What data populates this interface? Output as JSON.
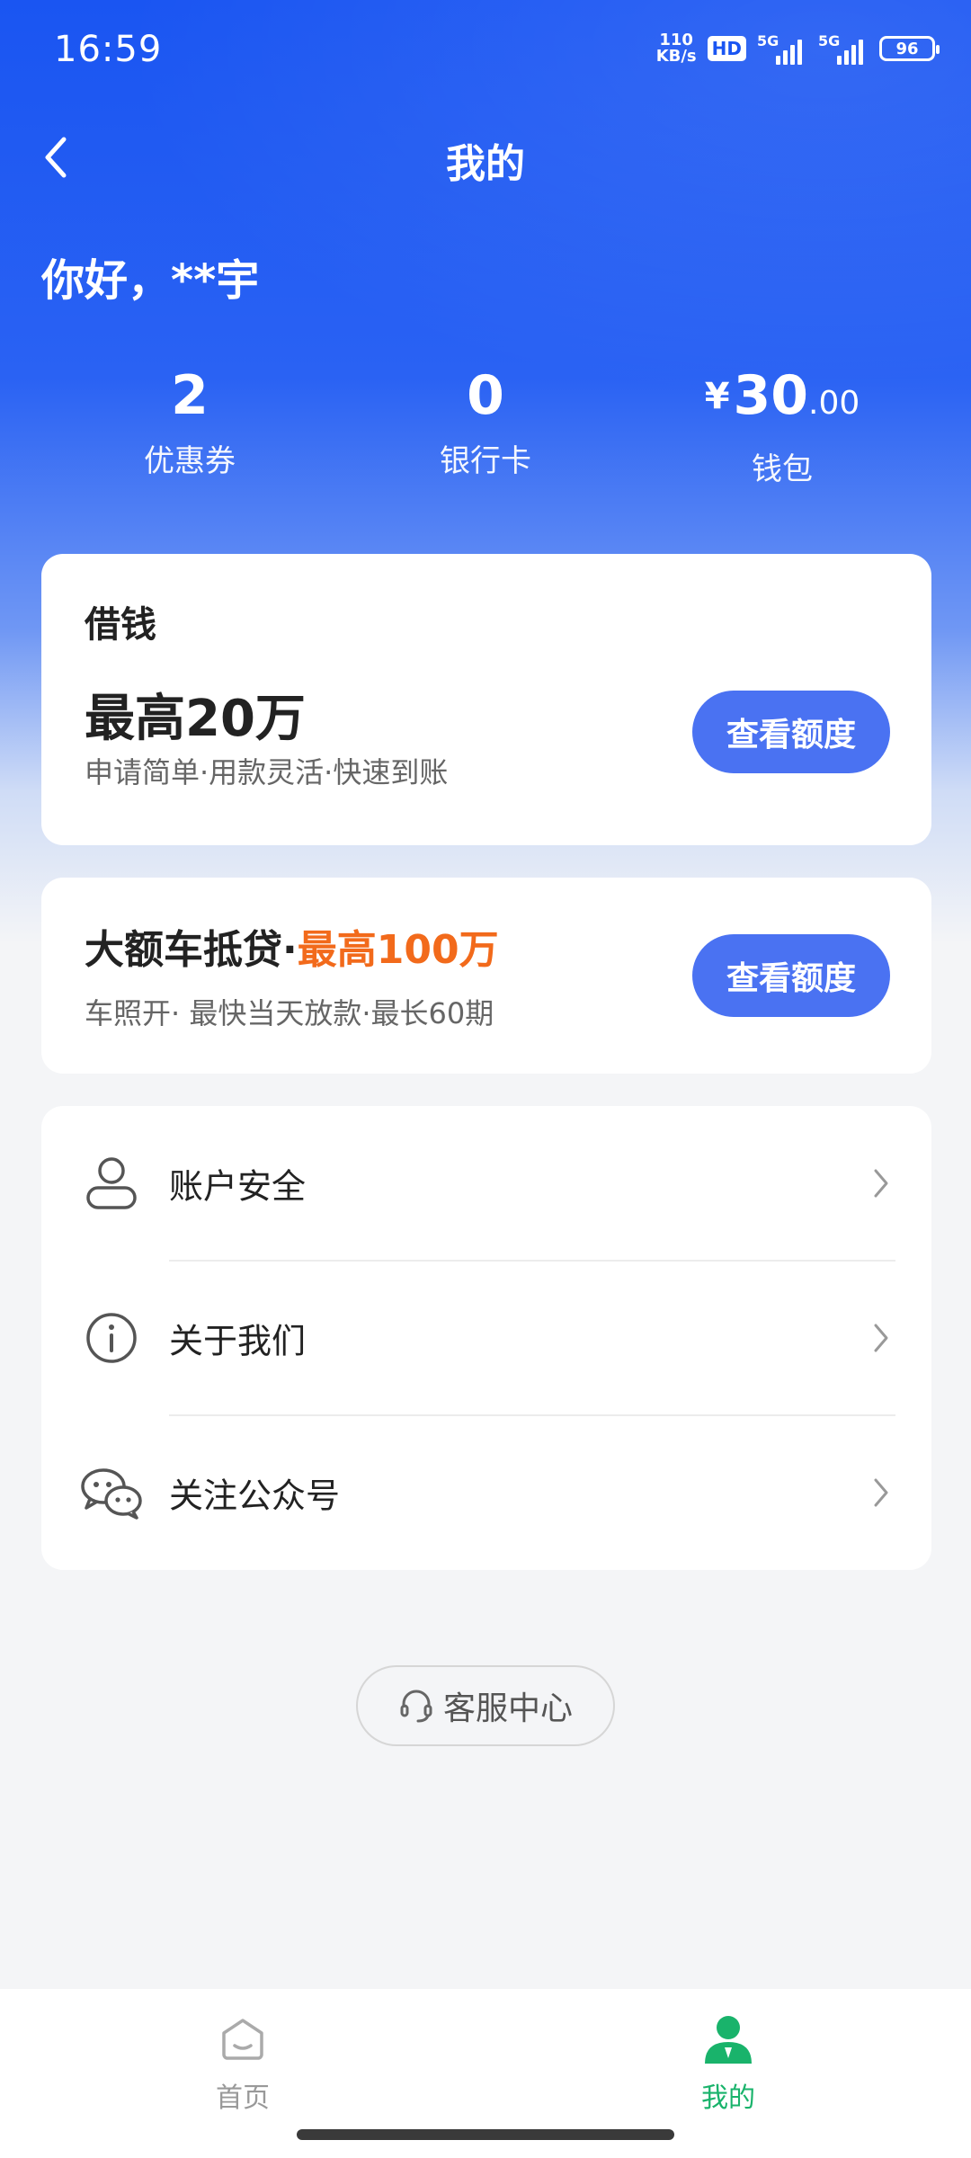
{
  "status_bar": {
    "time": "16:59",
    "net_speed_value": "110",
    "net_speed_unit": "KB/s",
    "hd_label": "HD",
    "sim1_label": "5G",
    "sim2_label": "5G",
    "battery": "96"
  },
  "nav": {
    "title": "我的"
  },
  "greeting": "你好，**宇",
  "stats": {
    "coupons": {
      "value": "2",
      "label": "优惠券"
    },
    "bank_cards": {
      "value": "0",
      "label": "银行卡"
    },
    "wallet": {
      "currency": "¥",
      "integer": "30",
      "decimal": ".00",
      "label": "钱包"
    }
  },
  "loan_card": {
    "label": "借钱",
    "headline": "最高20万",
    "description": "申请简单·用款灵活·快速到账",
    "button": "查看额度"
  },
  "car_loan_card": {
    "title_prefix": "大额车抵贷·",
    "title_highlight": "最高100万",
    "description": "车照开· 最快当天放款·最长60期",
    "button": "查看额度"
  },
  "menu": {
    "items": [
      {
        "label": "账户安全",
        "icon": "user-icon"
      },
      {
        "label": "关于我们",
        "icon": "info-icon"
      },
      {
        "label": "关注公众号",
        "icon": "wechat-icon"
      }
    ]
  },
  "customer_service": {
    "label": "客服中心",
    "icon": "headset-icon"
  },
  "tabbar": {
    "tabs": [
      {
        "label": "首页",
        "icon": "home-icon",
        "active": false
      },
      {
        "label": "我的",
        "icon": "person-icon",
        "active": true
      }
    ]
  },
  "colors": {
    "brand_blue": "#1a55f2",
    "button_blue": "#4a72f2",
    "highlight_orange": "#f26a1b",
    "active_tab_green": "#19b36b"
  }
}
